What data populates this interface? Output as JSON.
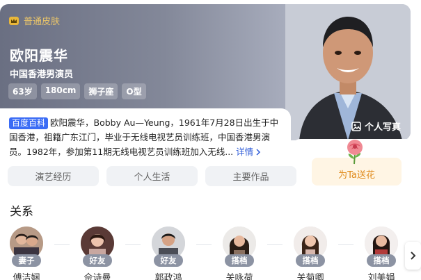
{
  "hero": {
    "skin_label": "普通皮肤",
    "name": "欧阳震华",
    "subtitle": "中国香港男演员",
    "tags": [
      "63岁",
      "180cm",
      "狮子座",
      "O型"
    ],
    "photo_label": "个人写真"
  },
  "bio": {
    "badge": "百度百科",
    "text": "欧阳震华，Bobby Au—Yeung，1961年7月28日出生于中国香港，祖籍广东江门，毕业于无线电视艺员训练班，中国香港男演员。1982年，参加第11期无线电视艺员训练班加入无线...",
    "more_label": "详情"
  },
  "tabs": [
    "演艺经历",
    "个人生活",
    "主要作品"
  ],
  "flower_label": "为Ta送花",
  "relations": {
    "title": "关系",
    "items": [
      {
        "badge": "妻子",
        "name": "傅洁娴"
      },
      {
        "badge": "好友",
        "name": "佘诗曼"
      },
      {
        "badge": "好友",
        "name": "郭政鸿"
      },
      {
        "badge": "搭档",
        "name": "关咏荷"
      },
      {
        "badge": "搭档",
        "name": "关菊卿"
      },
      {
        "badge": "搭档",
        "name": "刘美娟"
      }
    ]
  },
  "colors": {
    "accent_blue": "#3b6cf5",
    "gold": "#e9c46a",
    "flower_orange": "#e08a1a",
    "badge_gray": "#8c93a3"
  },
  "icons": [
    "skin-crown-icon",
    "photo-icon",
    "chevron-right-icon",
    "rose-icon",
    "next-arrow-icon"
  ]
}
